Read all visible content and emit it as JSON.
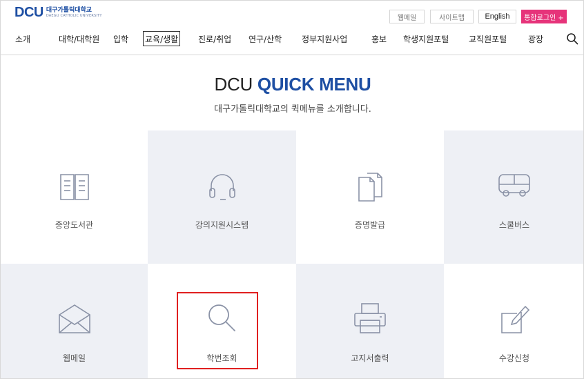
{
  "brand": {
    "logo_mark": "DCU",
    "logo_korean": "대구가톨릭대학교",
    "logo_english": "DAEGU CATHOLIC UNIVERSITY"
  },
  "utility": {
    "webmail": "웹메일",
    "sitemap": "사이트맵",
    "english": "English",
    "login": "통합로그인 +"
  },
  "nav": {
    "items": [
      "소개",
      "대학/대학원",
      "입학",
      "교육/생활",
      "진로/취업",
      "연구/산학",
      "정부지원사업",
      "홍보",
      "학생지원포털",
      "교직원포털",
      "광장"
    ],
    "active_index": 3
  },
  "heading": {
    "title_plain": "DCU",
    "title_accent": "QUICK MENU",
    "subtitle": "대구가톨릭대학교의 퀵메뉴를 소개합니다."
  },
  "quick_menu": [
    {
      "label": "중앙도서관",
      "icon": "book-icon"
    },
    {
      "label": "강의지원시스템",
      "icon": "headset-icon"
    },
    {
      "label": "증명발급",
      "icon": "documents-icon"
    },
    {
      "label": "스쿨버스",
      "icon": "bus-icon"
    },
    {
      "label": "웹메일",
      "icon": "envelope-icon"
    },
    {
      "label": "학번조회",
      "icon": "search-icon"
    },
    {
      "label": "고지서출력",
      "icon": "printer-icon"
    },
    {
      "label": "수강신청",
      "icon": "edit-icon"
    }
  ],
  "colors": {
    "brand_blue": "#1e4fa3",
    "login_pink": "#e6337a",
    "tile_shade": "#eef0f5",
    "icon_stroke": "#8a92a6",
    "highlight_red": "#e02020"
  }
}
